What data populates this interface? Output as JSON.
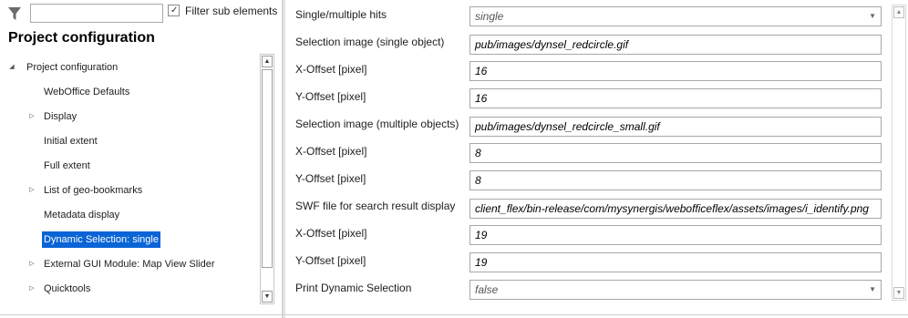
{
  "filter": {
    "input_value": "",
    "checkbox_checked": true,
    "checkbox_label": "Filter sub elements"
  },
  "panel_title": "Project configuration",
  "tree": {
    "items": [
      {
        "label": "Project configuration",
        "arrow": "expanded",
        "level": 0,
        "selected": false
      },
      {
        "label": "WebOffice Defaults",
        "arrow": "none",
        "level": 1,
        "selected": false
      },
      {
        "label": "Display",
        "arrow": "collapsed",
        "level": 1,
        "selected": false
      },
      {
        "label": "Initial extent",
        "arrow": "none",
        "level": 1,
        "selected": false
      },
      {
        "label": "Full extent",
        "arrow": "none",
        "level": 1,
        "selected": false
      },
      {
        "label": "List of geo-bookmarks",
        "arrow": "collapsed",
        "level": 1,
        "selected": false
      },
      {
        "label": "Metadata display",
        "arrow": "none",
        "level": 1,
        "selected": false
      },
      {
        "label": "Dynamic Selection: single",
        "arrow": "none",
        "level": 1,
        "selected": true
      },
      {
        "label": "External GUI Module: Map View Slider",
        "arrow": "collapsed",
        "level": 1,
        "selected": false
      },
      {
        "label": "Quicktools",
        "arrow": "collapsed",
        "level": 1,
        "selected": false
      }
    ]
  },
  "properties": [
    {
      "label": "Single/multiple hits",
      "value": "single",
      "type": "select"
    },
    {
      "label": "Selection image (single object)",
      "value": "pub/images/dynsel_redcircle.gif",
      "type": "text"
    },
    {
      "label": "X-Offset [pixel]",
      "value": "16",
      "type": "text"
    },
    {
      "label": "Y-Offset [pixel]",
      "value": "16",
      "type": "text"
    },
    {
      "label": "Selection image (multiple objects)",
      "value": "pub/images/dynsel_redcircle_small.gif",
      "type": "text"
    },
    {
      "label": "X-Offset [pixel]",
      "value": "8",
      "type": "text"
    },
    {
      "label": "Y-Offset [pixel]",
      "value": "8",
      "type": "text"
    },
    {
      "label": "SWF file for search result display",
      "value": "client_flex/bin-release/com/mysynergis/webofficeflex/assets/images/i_identify.png",
      "type": "text"
    },
    {
      "label": "X-Offset [pixel]",
      "value": "19",
      "type": "text"
    },
    {
      "label": "Y-Offset [pixel]",
      "value": "19",
      "type": "text"
    },
    {
      "label": "Print Dynamic Selection",
      "value": "false",
      "type": "select"
    }
  ],
  "colors": {
    "selection": "#0a64d6",
    "border": "#a8a8a8"
  }
}
